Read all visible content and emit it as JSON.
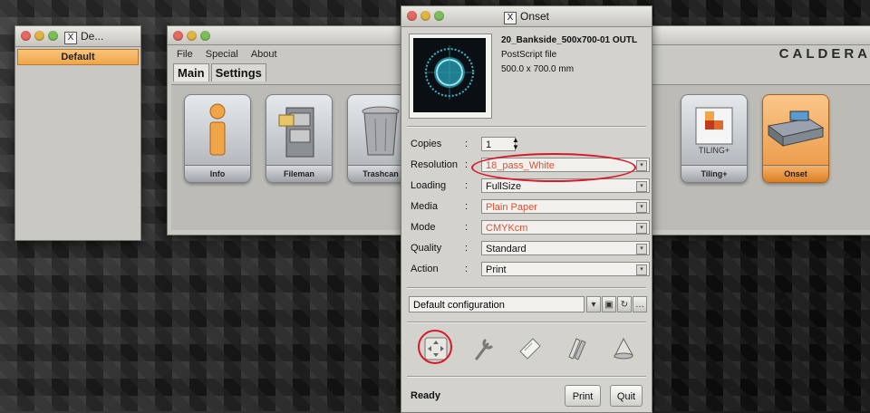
{
  "left_window": {
    "title": "De...",
    "item": "Default"
  },
  "main_window": {
    "menu": [
      "File",
      "Special",
      "About"
    ],
    "tabs": [
      "Main",
      "Settings"
    ],
    "tiles": [
      "Info",
      "Fileman",
      "Trashcan",
      "Tiling+",
      "Onset"
    ],
    "brand": "CALDERA"
  },
  "onset_window": {
    "title": "Onset",
    "file": {
      "name": "20_Bankside_500x700-01 OUTL",
      "type": "PostScript file",
      "size": "500.0 x 700.0 mm"
    },
    "fields": {
      "copies_label": "Copies",
      "copies_value": "1",
      "resolution_label": "Resolution",
      "resolution_value": "18_pass_White",
      "loading_label": "Loading",
      "loading_value": "FullSize",
      "media_label": "Media",
      "media_value": "Plain Paper",
      "mode_label": "Mode",
      "mode_value": "CMYKcm",
      "quality_label": "Quality",
      "quality_value": "Standard",
      "action_label": "Action",
      "action_value": "Print"
    },
    "config": "Default configuration",
    "status": "Ready",
    "print_button": "Print",
    "quit_button": "Quit"
  },
  "colors": {
    "accent_orange": "#f0a548",
    "highlight_red": "#d8192a",
    "field_red_text": "#e0502f"
  }
}
